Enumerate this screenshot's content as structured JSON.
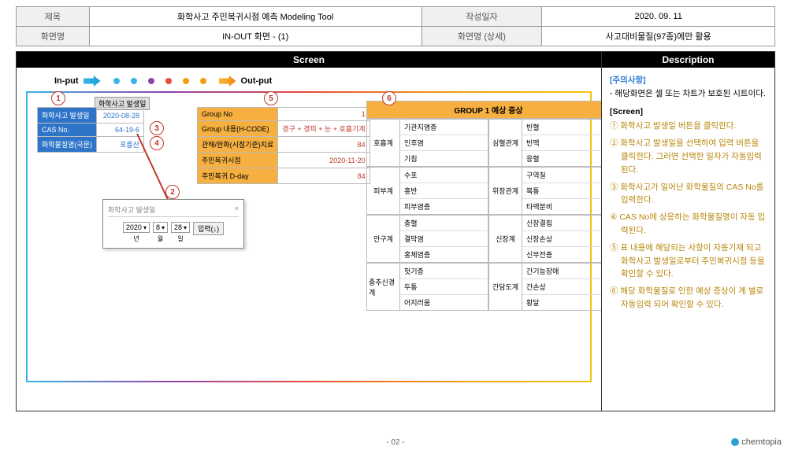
{
  "header": {
    "title_label": "제목",
    "title": "화학사고 주민복귀시점 예측 Modeling Tool",
    "date_label": "작성일자",
    "date": "2020. 09. 11",
    "screen_label": "화면명",
    "screen": "IN-OUT 화면 - (1)",
    "detail_label": "화면명 (상세)",
    "detail": "사고대비물질(97종)에만 활용"
  },
  "section": {
    "screen": "Screen",
    "desc": "Description"
  },
  "inout": {
    "in": "In-put",
    "out": "Out-put"
  },
  "dots": [
    "#3bb3e6",
    "#3bb3e6",
    "#8e44ad",
    "#e74c3c",
    "#f39c12",
    "#f39c12"
  ],
  "circles": {
    "c1": "1",
    "c2": "2",
    "c3": "3",
    "c4": "4",
    "c5": "5",
    "c6": "6"
  },
  "date_btn": {
    "label": "화학사고 발생일"
  },
  "input_tbl": {
    "r1l": "화학사고 발생일",
    "r1v": "2020-08-28",
    "r2l": "CAS No.",
    "r2v": "64-19-6",
    "r3l": "화학물질명(국문)",
    "r3v": "포름산"
  },
  "group_tbl": {
    "r1l": "Group No",
    "r1v": "1",
    "r2l": "Group 내용(H-CODE)",
    "r2v": "경구 + 경피 + 눈 + 호흡기계",
    "r3l": "관해/완화(시점기준)치료",
    "r3v": "84",
    "r4l": "주민복귀시점",
    "r4v": "2020-11-20",
    "r5l": "주민복귀 D-day",
    "r5v": "84"
  },
  "popup": {
    "title": "화학사고 발생일",
    "close": "×",
    "y": "2020",
    "m": "8",
    "d": "28",
    "yl": "년",
    "ml": "월",
    "dl": "일",
    "btn": "입력(↓)"
  },
  "symptom": {
    "title": "GROUP 1 예상 증상",
    "left": [
      {
        "cat": "호흡계",
        "items": [
          "기관지염증",
          "인후염",
          "기침"
        ]
      },
      {
        "cat": "피부계",
        "items": [
          "수포",
          "홍반",
          "피부염증"
        ]
      },
      {
        "cat": "안구계",
        "items": [
          "충혈",
          "결막염",
          "홍체염증"
        ]
      },
      {
        "cat": "중추신경계",
        "items": [
          "헛기증",
          "두통",
          "어지러움"
        ]
      }
    ],
    "right": [
      {
        "cat": "심혈관계",
        "items": [
          "빈혈",
          "빈맥",
          "응혈"
        ]
      },
      {
        "cat": "위장관계",
        "items": [
          "구역질",
          "복통",
          "타액분비"
        ]
      },
      {
        "cat": "신장계",
        "items": [
          "신장결핍",
          "신장손상",
          "신부전증"
        ]
      },
      {
        "cat": "간담도계",
        "items": [
          "간기능장애",
          "간손상",
          "황달"
        ]
      }
    ]
  },
  "desc": {
    "warn": "[주의사항]",
    "note": "- 해당화면은 셀 또는 차트가 보호된 시트이다.",
    "sect": "[Screen]",
    "s1": "① 화학사고 발생일 버튼을 클릭한다.",
    "s2": "② 화학사고 발생일을 선택하여 입력 버튼을 클릭한다. 그러면 선택한 일자가 자동입력 된다.",
    "s3": "③ 화학사고가 일어난 화학물질의 CAS No를 입력한다.",
    "s4": "④ CAS No에 상응하는 화학물질명이 자동 입력된다.",
    "s5": "⑤ 표 내용에 해당되는 사항이 자동기재 되고 화학사고 발생일로부터 주민복귀시점 등을 확인할 수 있다.",
    "s6": "⑥ 해당 화학물질로 인한 예상 증상이 계 별로 자동입력 되어 확인할 수 있다."
  },
  "page": "- 02 -",
  "brand": "chemtopia"
}
